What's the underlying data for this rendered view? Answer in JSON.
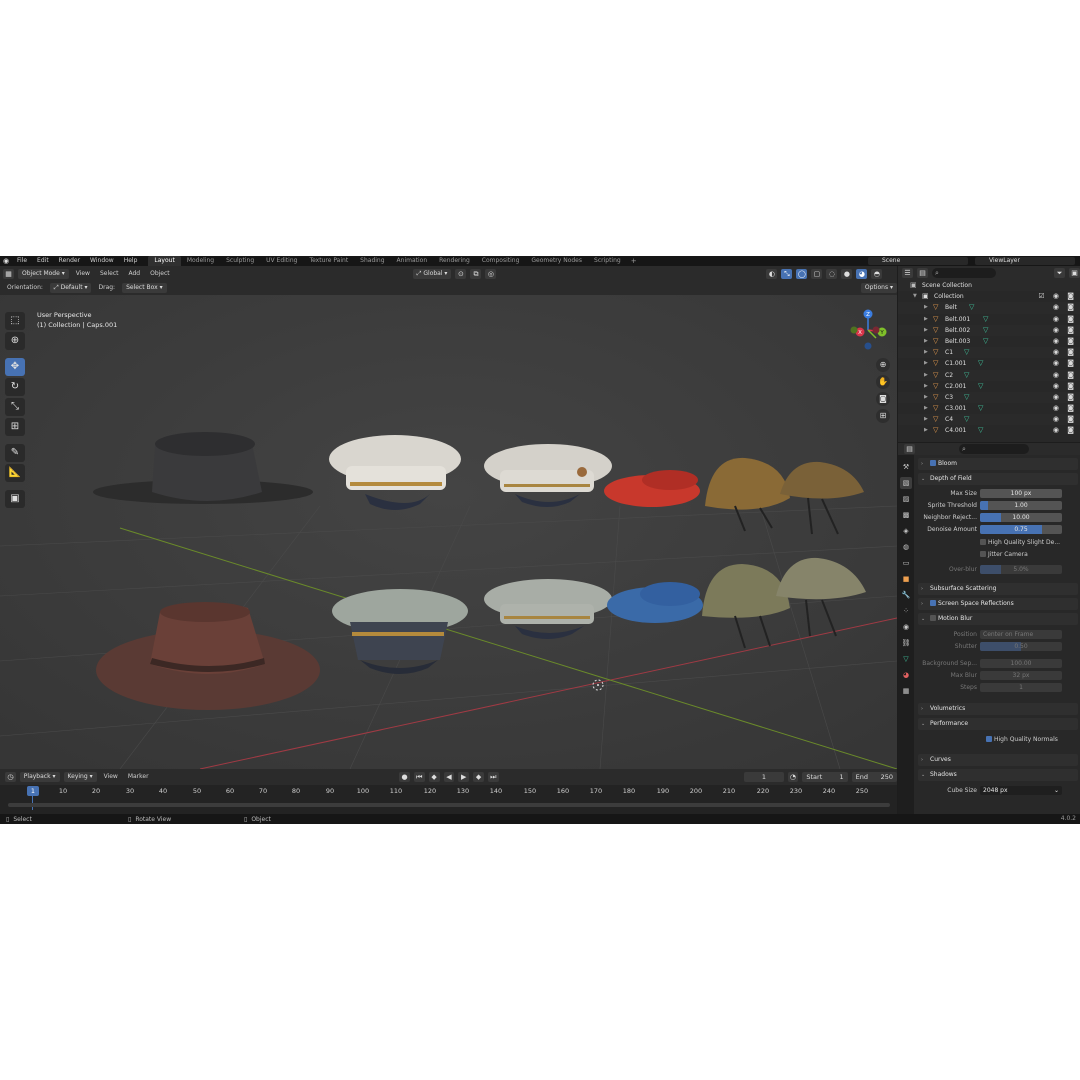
{
  "topbar": {
    "menus": [
      "File",
      "Edit",
      "Render",
      "Window",
      "Help"
    ],
    "workspaces": [
      "Layout",
      "Modeling",
      "Sculpting",
      "UV Editing",
      "Texture Paint",
      "Shading",
      "Animation",
      "Rendering",
      "Compositing",
      "Geometry Nodes",
      "Scripting"
    ],
    "active_workspace": "Layout",
    "scene": "Scene",
    "view_layer": "ViewLayer"
  },
  "viewport": {
    "mode": "Object Mode",
    "menus": [
      "View",
      "Select",
      "Add",
      "Object"
    ],
    "transform": "Global",
    "orientation_label": "Orientation:",
    "orientation_value": "Default",
    "drag_label": "Drag:",
    "drag_value": "Select Box",
    "options": "Options",
    "view_name": "User Perspective",
    "collection_info": "(1) Collection | Caps.001",
    "gizmo_axes": {
      "x": "X",
      "y": "Y",
      "z": "Z"
    }
  },
  "timeline": {
    "menus": [
      "Playback",
      "Keying",
      "View",
      "Marker"
    ],
    "current_frame": "1",
    "start_label": "Start",
    "start_value": "1",
    "end_label": "End",
    "end_value": "250",
    "ticks": [
      "10",
      "20",
      "30",
      "40",
      "50",
      "60",
      "70",
      "80",
      "90",
      "100",
      "110",
      "120",
      "130",
      "140",
      "150",
      "160",
      "170",
      "180",
      "190",
      "200",
      "210",
      "220",
      "230",
      "240",
      "250"
    ],
    "marker": "1"
  },
  "statusbar": {
    "select": "Select",
    "rotate": "Rotate View",
    "object": "Object",
    "version": "4.0.2"
  },
  "outliner": {
    "scene_collection": "Scene Collection",
    "collection": "Collection",
    "items": [
      "Belt",
      "Belt.001",
      "Belt.002",
      "Belt.003",
      "C1",
      "C1.001",
      "C2",
      "C2.001",
      "C3",
      "C3.001",
      "C4",
      "C4.001"
    ]
  },
  "properties": {
    "bloom": "Bloom",
    "dof": "Depth of Field",
    "max_size_label": "Max Size",
    "max_size": "100 px",
    "sprite_label": "Sprite Threshold",
    "sprite": "1.00",
    "sprite_fill": 0.1,
    "neighbor_label": "Neighbor Reject...",
    "neighbor": "10.00",
    "neighbor_fill": 0.25,
    "denoise_label": "Denoise Amount",
    "denoise": "0.75",
    "denoise_fill": 0.75,
    "hq_slight": "High Quality Slight De...",
    "jitter": "Jitter Camera",
    "overblur_label": "Over-blur",
    "overblur": "5.0%",
    "overblur_fill": 0.25,
    "sss": "Subsurface Scattering",
    "ssr": "Screen Space Reflections",
    "motion_blur": "Motion Blur",
    "position_label": "Position",
    "position": "Center on Frame",
    "shutter_label": "Shutter",
    "shutter": "0.50",
    "shutter_fill": 0.5,
    "bg_sep_label": "Background Sep...",
    "bg_sep": "100.00",
    "max_blur_label": "Max Blur",
    "max_blur": "32 px",
    "steps_label": "Steps",
    "steps": "1",
    "volumetrics": "Volumetrics",
    "performance": "Performance",
    "hq_normals": "High Quality Normals",
    "curves": "Curves",
    "shadows": "Shadows",
    "cube_size_label": "Cube Size",
    "cube_size": "2048 px"
  },
  "colors": {
    "accent": "#4772b3",
    "viewport_bg": "#3d3d3d",
    "axis_x": "#d9354a",
    "axis_y": "#7fbf2a",
    "axis_z": "#3b7de0",
    "object_icon": "#ed9f4f",
    "mesh_icon": "#40c69f"
  }
}
